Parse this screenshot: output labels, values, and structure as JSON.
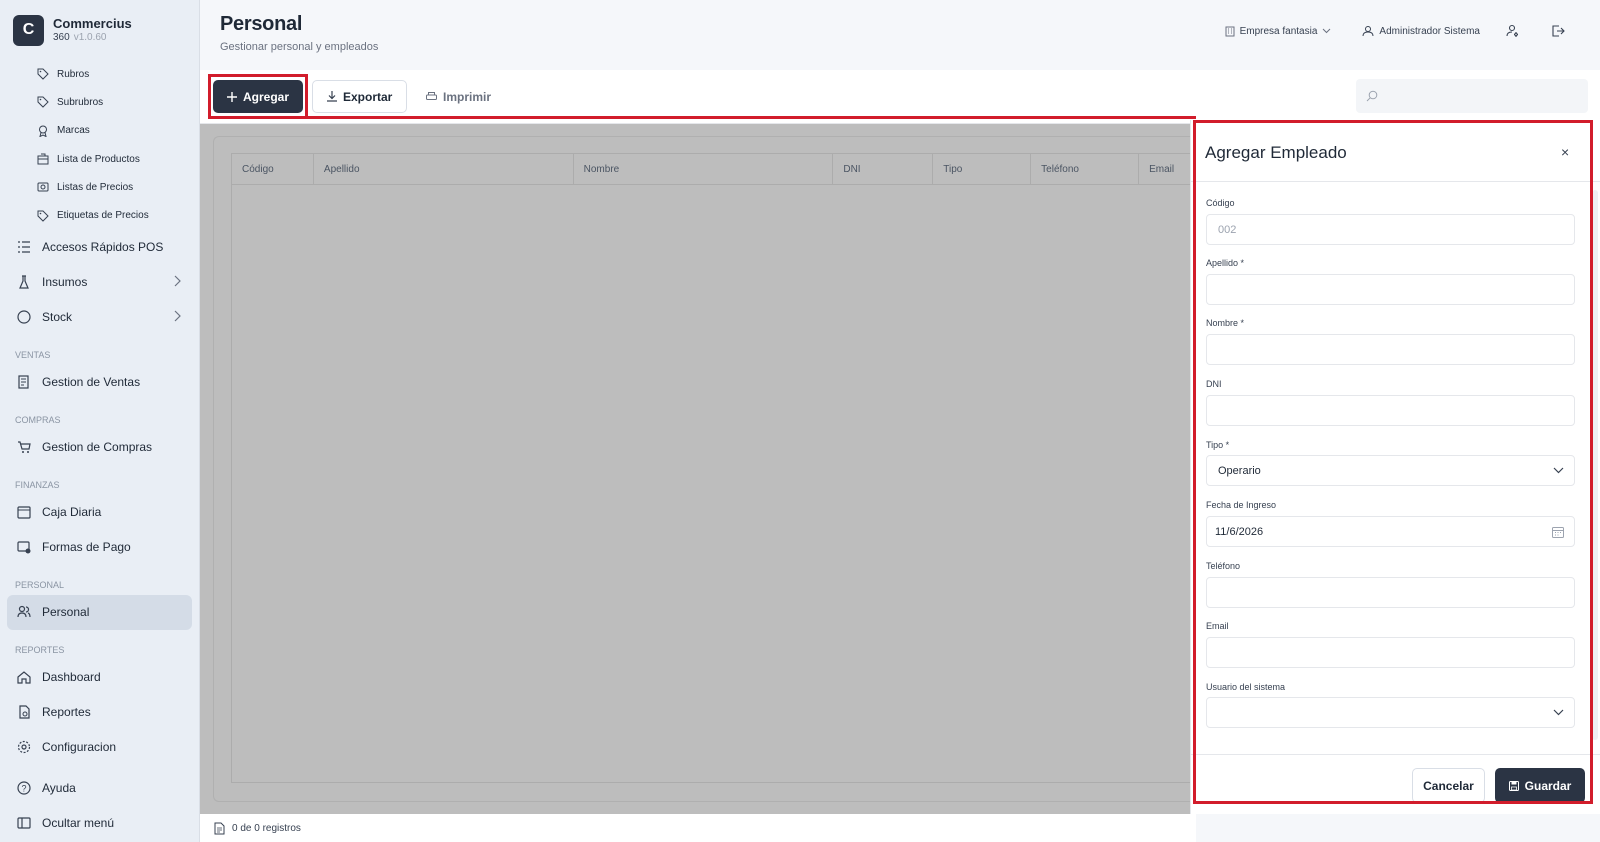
{
  "app": {
    "name": "Commercius",
    "sub": "360",
    "version": "v1.0.60"
  },
  "sidebar": {
    "sub_items": [
      {
        "label": "Rubros",
        "icon": "tag-icon"
      },
      {
        "label": "Subrubros",
        "icon": "tag-icon"
      },
      {
        "label": "Marcas",
        "icon": "award-icon"
      },
      {
        "label": "Lista de Productos",
        "icon": "boxes-icon"
      },
      {
        "label": "Listas de Precios",
        "icon": "price-list-icon"
      },
      {
        "label": "Etiquetas de Precios",
        "icon": "tag-icon"
      }
    ],
    "items_top": [
      {
        "label": "Accesos Rápidos POS",
        "icon": "list-icon"
      },
      {
        "label": "Insumos",
        "icon": "flask-icon",
        "has_children": true
      },
      {
        "label": "Stock",
        "icon": "circle-icon",
        "has_children": true
      }
    ],
    "sections": {
      "ventas": "VENTAS",
      "compras": "COMPRAS",
      "finanzas": "FINANZAS",
      "personal": "PERSONAL",
      "reportes": "REPORTES"
    },
    "ventas_item": "Gestion de Ventas",
    "compras_item": "Gestion de Compras",
    "finanzas_items": [
      "Caja Diaria",
      "Formas de Pago"
    ],
    "personal_item": "Personal",
    "reportes_items": [
      "Dashboard",
      "Reportes",
      "Configuracion"
    ],
    "ayuda": "Ayuda",
    "ocultar": "Ocultar menú"
  },
  "header": {
    "title": "Personal",
    "subtitle": "Gestionar personal y empleados",
    "company": "Empresa fantasia",
    "user": "Administrador Sistema"
  },
  "toolbar": {
    "add_label": "Agregar",
    "export_label": "Exportar",
    "print_label": "Imprimir",
    "search_placeholder": ""
  },
  "table": {
    "columns": [
      "Código",
      "Apellido",
      "Nombre",
      "DNI",
      "Tipo",
      "Teléfono",
      "Email"
    ],
    "rows": []
  },
  "footer": {
    "records": "0 de 0 registros"
  },
  "drawer": {
    "title": "Agregar Empleado",
    "close": "×",
    "fields": {
      "codigo": {
        "label": "Código",
        "placeholder": "002"
      },
      "apellido": {
        "label": "Apellido *",
        "value": ""
      },
      "nombre": {
        "label": "Nombre *",
        "value": ""
      },
      "dni": {
        "label": "DNI",
        "value": ""
      },
      "tipo": {
        "label": "Tipo *",
        "value": "Operario"
      },
      "fecha": {
        "label": "Fecha de Ingreso",
        "value": "11/6/2026"
      },
      "telefono": {
        "label": "Teléfono",
        "value": ""
      },
      "email": {
        "label": "Email",
        "value": ""
      },
      "usuario": {
        "label": "Usuario del sistema",
        "value": ""
      }
    },
    "cancel_label": "Cancelar",
    "save_label": "Guardar"
  },
  "colors": {
    "primary": "#2b3444",
    "highlight": "#d21c2b",
    "sidebar_bg": "#e9eef5",
    "overlay": "#bdbdbd"
  }
}
